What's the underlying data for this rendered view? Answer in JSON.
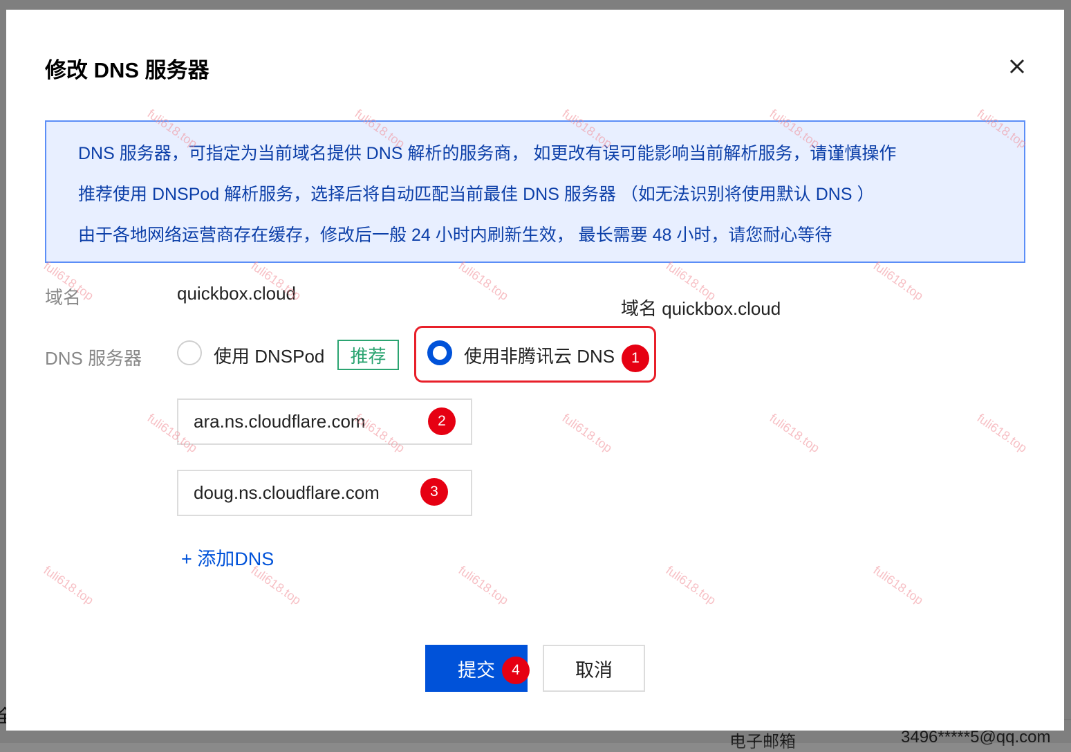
{
  "background": {
    "left_char": "全",
    "email_label": "电子邮箱",
    "email_value": "3496*****5@qq.com"
  },
  "dialog": {
    "title": "修改 DNS 服务器",
    "close_icon": "close-icon",
    "notice": {
      "lines": [
        "DNS 服务器，可指定为当前域名提供 DNS 解析的服务商， 如更改有误可能影响当前解析服务，请谨慎操作",
        "推荐使用 DNSPod 解析服务，选择后将自动匹配当前最佳 DNS 服务器 （如无法识别将使用默认 DNS ）",
        "由于各地网络运营商存在缓存，修改后一般 24 小时内刷新生效， 最长需要 48 小时，请您耐心等待"
      ]
    },
    "domain": {
      "label": "域名",
      "value": "quickbox.cloud",
      "annotation": "域名 quickbox.cloud"
    },
    "dns_server": {
      "label": "DNS 服务器",
      "option_dnspod": "使用 DNSPod",
      "recommend_badge": "推荐",
      "option_other": "使用非腾讯云 DNS",
      "selected": "option_other"
    },
    "dns_inputs": [
      {
        "value": "ara.ns.cloudflare.com"
      },
      {
        "value": "doug.ns.cloudflare.com"
      }
    ],
    "add_dns": "+ 添加DNS",
    "buttons": {
      "submit": "提交",
      "cancel": "取消"
    },
    "step_markers": [
      "1",
      "2",
      "3",
      "4"
    ],
    "watermark": "fuli618.top"
  }
}
